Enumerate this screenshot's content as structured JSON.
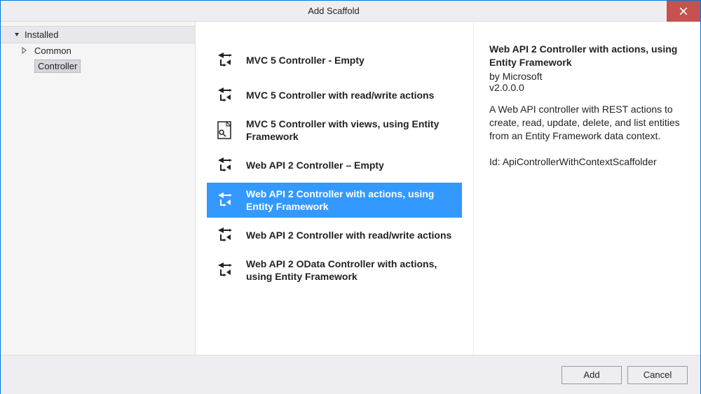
{
  "window": {
    "title": "Add Scaffold"
  },
  "sidebar": {
    "root": "Installed",
    "items": [
      {
        "label": "Common",
        "expandable": true
      },
      {
        "label": "Controller",
        "selected": true
      }
    ]
  },
  "scaffolds": [
    {
      "label": "MVC 5 Controller - Empty",
      "icon": "controller"
    },
    {
      "label": "MVC 5 Controller with read/write actions",
      "icon": "controller"
    },
    {
      "label": "MVC 5 Controller with views, using Entity Framework",
      "icon": "controller-page"
    },
    {
      "label": "Web API 2 Controller – Empty",
      "icon": "controller"
    },
    {
      "label": "Web API 2 Controller with actions, using Entity Framework",
      "icon": "controller",
      "selected": true
    },
    {
      "label": "Web API 2 Controller with read/write actions",
      "icon": "controller"
    },
    {
      "label": "Web API 2 OData Controller with actions, using Entity Framework",
      "icon": "controller"
    }
  ],
  "details": {
    "title": "Web API 2 Controller with actions, using Entity Framework",
    "by_prefix": "by ",
    "author": "Microsoft",
    "version": "v2.0.0.0",
    "description": "A Web API controller with REST actions to create, read, update, delete, and list entities from an Entity Framework data context.",
    "id_prefix": "Id: ",
    "id": "ApiControllerWithContextScaffolder"
  },
  "footer": {
    "add": "Add",
    "cancel": "Cancel"
  }
}
